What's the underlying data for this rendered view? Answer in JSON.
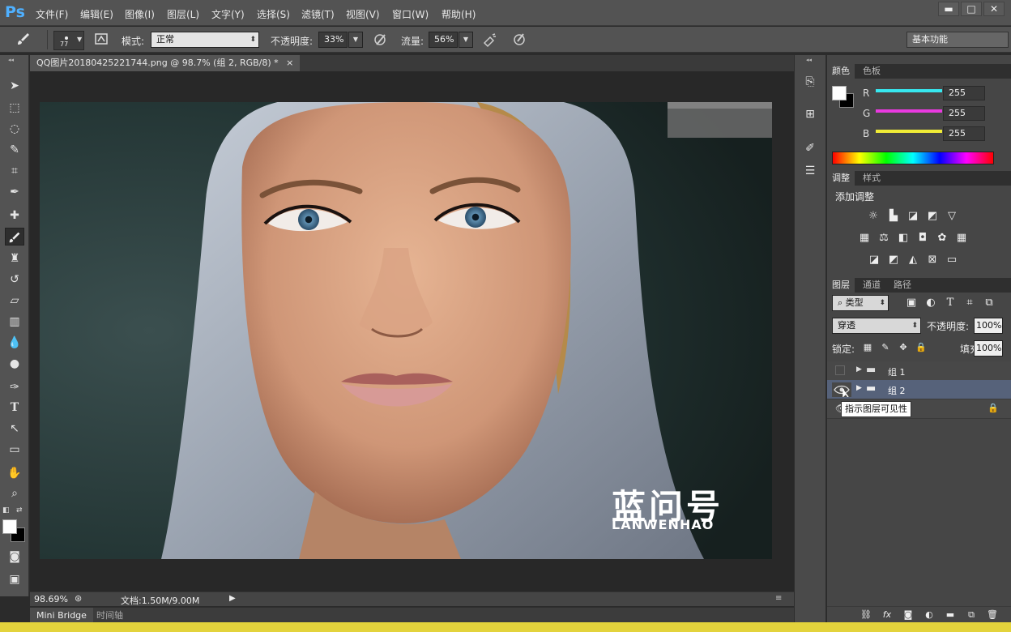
{
  "app": {
    "logo": "Ps"
  },
  "menu": [
    "文件(F)",
    "编辑(E)",
    "图像(I)",
    "图层(L)",
    "文字(Y)",
    "选择(S)",
    "滤镜(T)",
    "视图(V)",
    "窗口(W)",
    "帮助(H)"
  ],
  "window_controls": {
    "minimize": "▬",
    "maximize": "□",
    "close": "✕"
  },
  "options": {
    "brush_size": "77",
    "mode_label": "模式:",
    "mode_value": "正常",
    "opacity_label": "不透明度:",
    "opacity_value": "33%",
    "flow_label": "流量:",
    "flow_value": "56%",
    "workspace": "基本功能"
  },
  "document": {
    "tab_title": "QQ图片20180425221744.png @ 98.7% (组 2, RGB/8) *",
    "tab_close": "×",
    "watermark_cn": "蓝问号",
    "watermark_en": "LANWENHAO"
  },
  "status": {
    "zoom": "98.69%",
    "doc_info": "文档:1.50M/9.00M"
  },
  "bottom_tabs": [
    "Mini Bridge",
    "时间轴"
  ],
  "color_panel": {
    "tabs": [
      "颜色",
      "色板"
    ],
    "channels": [
      {
        "label": "R",
        "value": "255",
        "color": "#37e8f0"
      },
      {
        "label": "G",
        "value": "255",
        "color": "#ea3ae0"
      },
      {
        "label": "B",
        "value": "255",
        "color": "#f0ec36"
      }
    ]
  },
  "adjust_panel": {
    "tabs": [
      "调整",
      "样式"
    ],
    "title": "添加调整"
  },
  "layers_panel": {
    "tabs": [
      "图层",
      "通道",
      "路径"
    ],
    "filter_type": "类型",
    "blend_mode": "穿透",
    "opacity_label": "不透明度:",
    "opacity_value": "100%",
    "lock_label": "锁定:",
    "fill_label": "填充:",
    "fill_value": "100%",
    "layers": [
      {
        "name": "组 1",
        "visible": false
      },
      {
        "name": "组 2",
        "visible": true,
        "selected": true
      }
    ],
    "tooltip": "指示图层可见性"
  },
  "colors": {
    "accent": "#4fb0ff",
    "selection": "#56627a",
    "chrome": "#535353"
  }
}
